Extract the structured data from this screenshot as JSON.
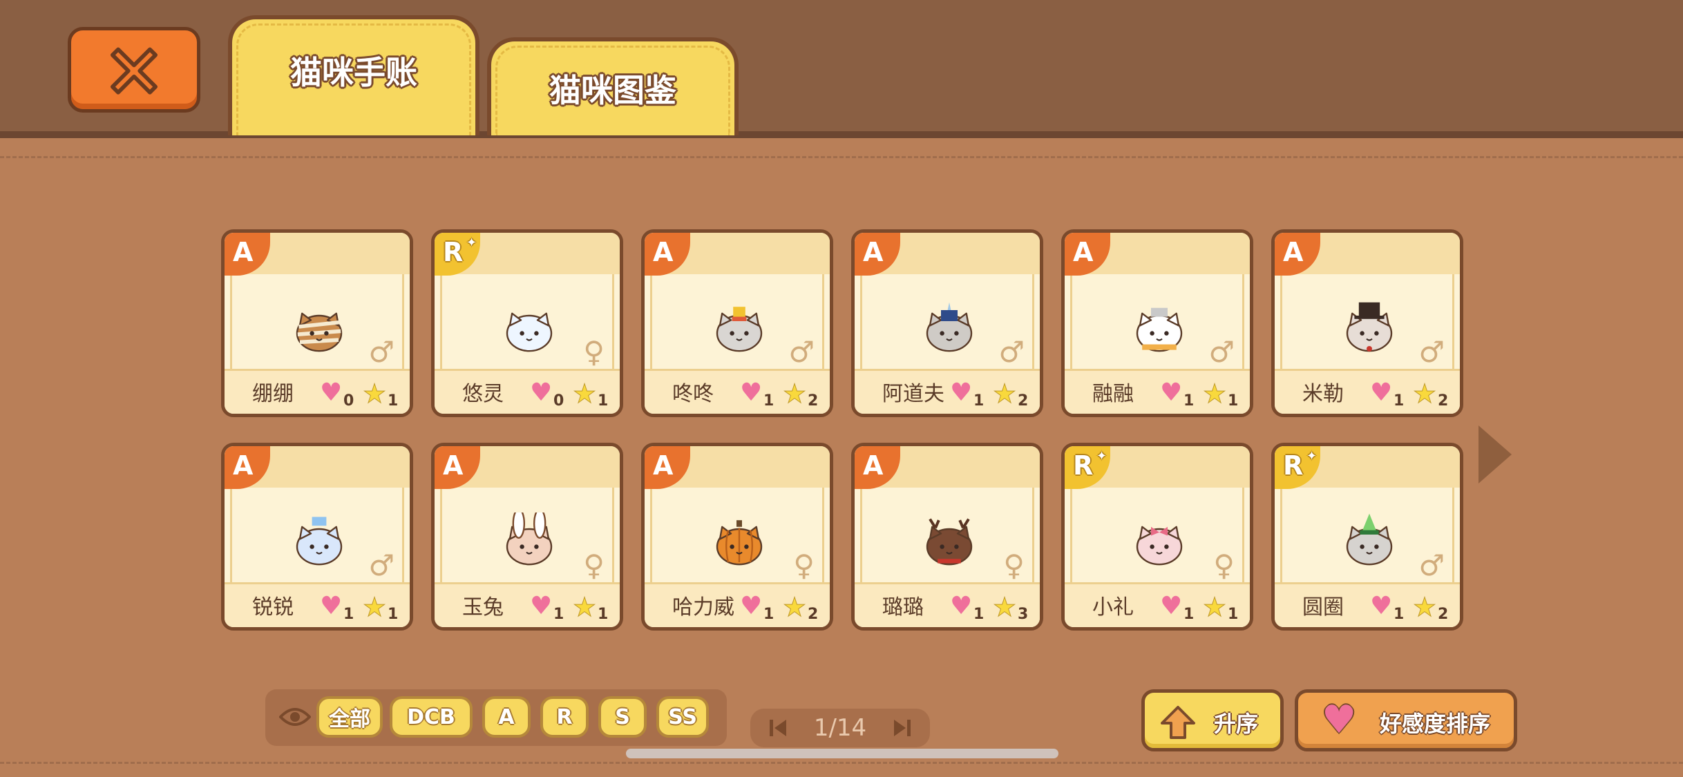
{
  "tabs": [
    {
      "label": "猫咪手账",
      "active": true
    },
    {
      "label": "猫咪图鉴",
      "active": false
    }
  ],
  "close_icon": "close-x-icon",
  "cats": [
    {
      "name": "绷绷",
      "rarity": "A",
      "gender": "♂",
      "affection": "0",
      "stars": "1",
      "face": "mummy"
    },
    {
      "name": "悠灵",
      "rarity": "R",
      "gender": "♀",
      "affection": "0",
      "stars": "1",
      "face": "ghost"
    },
    {
      "name": "咚咚",
      "rarity": "A",
      "gender": "♂",
      "affection": "1",
      "stars": "2",
      "face": "drummer"
    },
    {
      "name": "阿道夫",
      "rarity": "A",
      "gender": "♂",
      "affection": "1",
      "stars": "2",
      "face": "guard"
    },
    {
      "name": "融融",
      "rarity": "A",
      "gender": "♂",
      "affection": "1",
      "stars": "1",
      "face": "snowman"
    },
    {
      "name": "米勒",
      "rarity": "A",
      "gender": "♂",
      "affection": "1",
      "stars": "2",
      "face": "tophat"
    },
    {
      "name": "锐锐",
      "rarity": "A",
      "gender": "♂",
      "affection": "1",
      "stars": "1",
      "face": "bottle"
    },
    {
      "name": "玉兔",
      "rarity": "A",
      "gender": "♀",
      "affection": "1",
      "stars": "1",
      "face": "rabbit"
    },
    {
      "name": "哈力威",
      "rarity": "A",
      "gender": "♀",
      "affection": "1",
      "stars": "2",
      "face": "pumpkin"
    },
    {
      "name": "璐璐",
      "rarity": "A",
      "gender": "♀",
      "affection": "1",
      "stars": "3",
      "face": "reindeer"
    },
    {
      "name": "小礼",
      "rarity": "R",
      "gender": "♀",
      "affection": "1",
      "stars": "1",
      "face": "pinkbow"
    },
    {
      "name": "圆圈",
      "rarity": "R",
      "gender": "♂",
      "affection": "1",
      "stars": "2",
      "face": "tree"
    }
  ],
  "filters": {
    "eye_icon": "eye-icon",
    "buttons": [
      "全部",
      "DCB",
      "A",
      "R",
      "S",
      "SS"
    ]
  },
  "pager": {
    "text": "1/14"
  },
  "sort": {
    "ascending_label": "升序",
    "affinity_label": "好感度排序"
  },
  "colors": {
    "rarity_A": "#e8722e",
    "rarity_R": "#f2c230",
    "tab": "#f7d85f",
    "close": "#f27a2d",
    "heart": "#ef6f9b"
  }
}
